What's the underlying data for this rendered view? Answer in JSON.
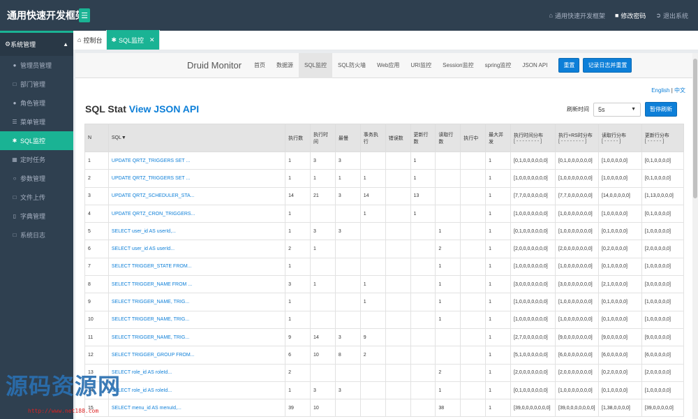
{
  "header": {
    "brand": "通用快速开发框架",
    "menu_icon": "menu-icon",
    "links": [
      {
        "icon": "home-icon",
        "label": "通用快速开发框架"
      },
      {
        "icon": "lock-icon",
        "label": "修改密码"
      },
      {
        "icon": "logout-icon",
        "label": "退出系统"
      }
    ]
  },
  "sidebar": {
    "group_label": "系统管理",
    "items": [
      {
        "icon": "user-icon",
        "label": "管理员管理"
      },
      {
        "icon": "document-icon",
        "label": "部门管理"
      },
      {
        "icon": "users-icon",
        "label": "角色管理"
      },
      {
        "icon": "list-icon",
        "label": "菜单管理"
      },
      {
        "icon": "bug-icon",
        "label": "SQL监控"
      },
      {
        "icon": "calendar-icon",
        "label": "定时任务"
      },
      {
        "icon": "circle-icon",
        "label": "参数管理"
      },
      {
        "icon": "file-icon",
        "label": "文件上传"
      },
      {
        "icon": "bookmark-icon",
        "label": "字典管理"
      },
      {
        "icon": "log-icon",
        "label": "系统日志"
      }
    ]
  },
  "tabs": [
    {
      "icon": "home-icon",
      "label": "控制台"
    },
    {
      "icon": "bug-icon",
      "label": "SQL监控"
    }
  ],
  "druid": {
    "brand": "Druid Monitor",
    "nav": [
      "首页",
      "数据源",
      "SQL监控",
      "SQL防火墙",
      "Web应用",
      "URI监控",
      "Session监控",
      "spring监控",
      "JSON API"
    ],
    "reset_label": "重置",
    "log_reset_label": "记录日志并重置",
    "lang_en": "English",
    "lang_sep": " | ",
    "lang_zh": "中文",
    "title": "SQL Stat",
    "title_link": "View JSON API",
    "refresh_label": "刷新时间",
    "refresh_value": "5s",
    "pause_label": "暂停刷新"
  },
  "table": {
    "headers": {
      "n": "N",
      "sql": "SQL▼",
      "exec_count": "执行数",
      "exec_time": "执行时间",
      "slowest": "最慢",
      "tx_exec": "事务执行",
      "errors": "错误数",
      "update_rows": "更新行数",
      "fetch_rows": "读取行数",
      "running": "执行中",
      "max_concurrent": "最大并发",
      "exec_hist": "执行时间分布",
      "exec_hist_sub": "[ - - - - - - - - ]",
      "exec_rs_hist": "执行+RS时分布",
      "exec_rs_hist_sub": "[ - - - - - - - - ]",
      "fetch_hist": "读取行分布",
      "fetch_hist_sub": "[ - - - - - ]",
      "update_hist": "更新行分布",
      "update_hist_sub": "[ - - - - - ]"
    },
    "rows": [
      [
        "1",
        "UPDATE QRTZ_TRIGGERS SET ...",
        "1",
        "3",
        "3",
        "",
        "",
        "1",
        "",
        "",
        "1",
        "[0,1,0,0,0,0,0,0]",
        "[0,1,0,0,0,0,0,0]",
        "[1,0,0,0,0,0]",
        "[0,1,0,0,0,0]"
      ],
      [
        "2",
        "UPDATE QRTZ_TRIGGERS SET ...",
        "1",
        "1",
        "1",
        "1",
        "",
        "1",
        "",
        "",
        "1",
        "[1,0,0,0,0,0,0,0]",
        "[1,0,0,0,0,0,0,0]",
        "[1,0,0,0,0,0]",
        "[0,1,0,0,0,0]"
      ],
      [
        "3",
        "UPDATE QRTZ_SCHEDULER_STA...",
        "14",
        "21",
        "3",
        "14",
        "",
        "13",
        "",
        "",
        "1",
        "[7,7,0,0,0,0,0,0]",
        "[7,7,0,0,0,0,0,0]",
        "[14,0,0,0,0,0]",
        "[1,13,0,0,0,0]"
      ],
      [
        "4",
        "UPDATE QRTZ_CRON_TRIGGERS...",
        "1",
        "",
        "",
        "1",
        "",
        "1",
        "",
        "",
        "1",
        "[1,0,0,0,0,0,0,0]",
        "[1,0,0,0,0,0,0,0]",
        "[1,0,0,0,0,0]",
        "[0,1,0,0,0,0]"
      ],
      [
        "5",
        "SELECT user_id AS userId,...",
        "1",
        "3",
        "3",
        "",
        "",
        "",
        "1",
        "",
        "1",
        "[0,1,0,0,0,0,0,0]",
        "[1,0,0,0,0,0,0,0]",
        "[0,1,0,0,0,0]",
        "[1,0,0,0,0,0]"
      ],
      [
        "6",
        "SELECT user_id AS userId...",
        "2",
        "1",
        "",
        "",
        "",
        "",
        "2",
        "",
        "1",
        "[2,0,0,0,0,0,0,0]",
        "[2,0,0,0,0,0,0,0]",
        "[0,2,0,0,0,0]",
        "[2,0,0,0,0,0]"
      ],
      [
        "7",
        "SELECT TRIGGER_STATE FROM...",
        "1",
        "",
        "",
        "",
        "",
        "",
        "1",
        "",
        "1",
        "[1,0,0,0,0,0,0,0]",
        "[1,0,0,0,0,0,0,0]",
        "[0,1,0,0,0,0]",
        "[1,0,0,0,0,0]"
      ],
      [
        "8",
        "SELECT TRIGGER_NAME FROM ...",
        "3",
        "1",
        "",
        "1",
        "",
        "",
        "1",
        "",
        "1",
        "[3,0,0,0,0,0,0,0]",
        "[3,0,0,0,0,0,0,0]",
        "[2,1,0,0,0,0]",
        "[3,0,0,0,0,0]"
      ],
      [
        "9",
        "SELECT TRIGGER_NAME, TRIG...",
        "1",
        "",
        "",
        "1",
        "",
        "",
        "1",
        "",
        "1",
        "[1,0,0,0,0,0,0,0]",
        "[1,0,0,0,0,0,0,0]",
        "[0,1,0,0,0,0]",
        "[1,0,0,0,0,0]"
      ],
      [
        "10",
        "SELECT TRIGGER_NAME, TRIG...",
        "1",
        "",
        "",
        "",
        "",
        "",
        "1",
        "",
        "1",
        "[1,0,0,0,0,0,0,0]",
        "[1,0,0,0,0,0,0,0]",
        "[0,1,0,0,0,0]",
        "[1,0,0,0,0,0]"
      ],
      [
        "11",
        "SELECT TRIGGER_NAME, TRIG...",
        "9",
        "14",
        "3",
        "9",
        "",
        "",
        "",
        "",
        "1",
        "[2,7,0,0,0,0,0,0]",
        "[9,0,0,0,0,0,0,0]",
        "[9,0,0,0,0,0]",
        "[9,0,0,0,0,0]"
      ],
      [
        "12",
        "SELECT TRIGGER_GROUP FROM...",
        "6",
        "10",
        "8",
        "2",
        "",
        "",
        "",
        "",
        "1",
        "[5,1,0,0,0,0,0,0]",
        "[6,0,0,0,0,0,0,0]",
        "[6,0,0,0,0,0]",
        "[6,0,0,0,0,0]"
      ],
      [
        "13",
        "SELECT role_id AS roleId...",
        "2",
        "",
        "",
        "",
        "",
        "",
        "2",
        "",
        "1",
        "[2,0,0,0,0,0,0,0]",
        "[2,0,0,0,0,0,0,0]",
        "[0,2,0,0,0,0]",
        "[2,0,0,0,0,0]"
      ],
      [
        "14",
        "SELECT role_id AS roleId...",
        "1",
        "3",
        "3",
        "",
        "",
        "",
        "1",
        "",
        "1",
        "[0,1,0,0,0,0,0,0]",
        "[1,0,0,0,0,0,0,0]",
        "[0,1,0,0,0,0]",
        "[1,0,0,0,0,0]"
      ],
      [
        "15",
        "SELECT menu_id AS menuId,...",
        "39",
        "10",
        "",
        "",
        "",
        "",
        "38",
        "",
        "1",
        "[39,0,0,0,0,0,0,0]",
        "[39,0,0,0,0,0,0,0]",
        "[1,38,0,0,0,0]",
        "[39,0,0,0,0,0]"
      ]
    ]
  },
  "watermark": {
    "text": "源码资源网",
    "url": "http://www.net188.com"
  }
}
